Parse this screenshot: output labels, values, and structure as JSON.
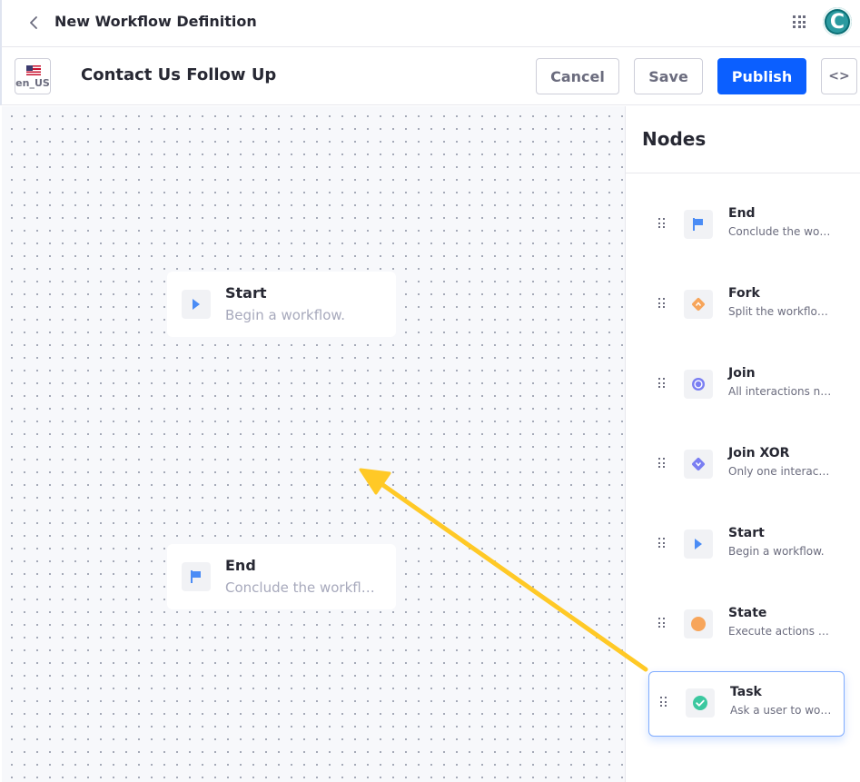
{
  "header": {
    "title": "New Workflow Definition",
    "back_icon": "chevron-left-icon",
    "apps_icon": "grid-icon",
    "avatar_initial": "C"
  },
  "toolbar": {
    "locale": "en_US",
    "workflow_name": "Contact Us Follow Up",
    "cancel_label": "Cancel",
    "save_label": "Save",
    "publish_label": "Publish",
    "code_label": "<>"
  },
  "canvas": {
    "nodes": [
      {
        "label": "Start",
        "description": "Begin a workflow.",
        "icon": "play-icon"
      },
      {
        "label": "End",
        "description": "Conclude the workflow.",
        "icon": "flag-icon"
      }
    ]
  },
  "sidebar": {
    "title": "Nodes",
    "items": [
      {
        "label": "End",
        "description": "Conclude the workflow.",
        "icon": "flag-icon",
        "color": "#4b8cf5"
      },
      {
        "label": "Fork",
        "description": "Split the workflow into multiple paths.",
        "icon": "fork-icon",
        "color": "#f7a55b"
      },
      {
        "label": "Join",
        "description": "All interactions need to be completed.",
        "icon": "join-icon",
        "color": "#7a7ef2"
      },
      {
        "label": "Join XOR",
        "description": "Only one interaction needs to be completed.",
        "icon": "join-xor-icon",
        "color": "#7a7ef2"
      },
      {
        "label": "Start",
        "description": "Begin a workflow.",
        "icon": "play-icon",
        "color": "#4b8cf5"
      },
      {
        "label": "State",
        "description": "Execute actions automatically.",
        "icon": "state-icon",
        "color": "#f7a55b"
      },
      {
        "label": "Task",
        "description": "Ask a user to work on the item.",
        "icon": "check-circle-icon",
        "color": "#3cc8a0"
      }
    ]
  },
  "colors": {
    "primary": "#0b5fff",
    "arrow": "#ffc926"
  }
}
